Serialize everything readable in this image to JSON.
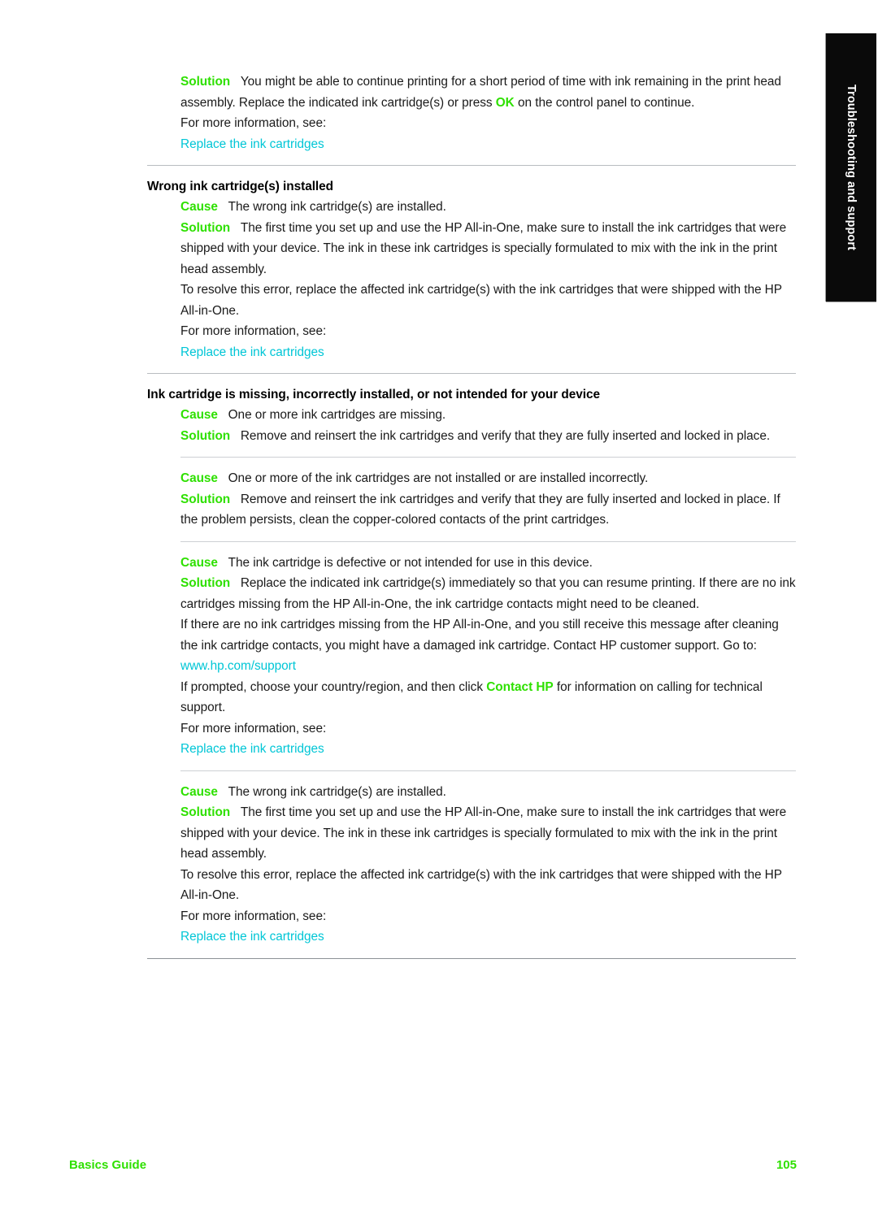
{
  "document": {
    "chapter_tab_label": "Troubleshooting and support",
    "footer_left": "Basics Guide",
    "footer_page_number": "105",
    "colors": {
      "label_green": "#2ee000",
      "link_cyan": "#00c6d6",
      "tab_background": "#0a0a0a",
      "rule_gray": "#b9bcc0"
    },
    "labels": {
      "cause": "Cause",
      "solution": "Solution",
      "for_more_information": "For more information, see:",
      "link_replace_cartridges": "Replace the ink cartridges",
      "link_support_url": "www.hp.com/support"
    }
  },
  "blocks": {
    "intro_solution": {
      "body_1": "You might be able to continue printing for a short period of time with ink remaining in the print head assembly. Replace the indicated ink cartridge(s) or press ",
      "inline_ok": "OK",
      "body_2": " on the control panel to continue."
    },
    "wrong_cartridge": {
      "heading": "Wrong ink cartridge(s) installed",
      "cause": "The wrong ink cartridge(s) are installed.",
      "solution_p1": "The first time you set up and use the HP All-in-One, make sure to install the ink cartridges that were shipped with your device. The ink in these ink cartridges is specially formulated to mix with the ink in the print head assembly.",
      "solution_p2": "To resolve this error, replace the affected ink cartridge(s) with the ink cartridges that were shipped with the HP All-in-One."
    },
    "missing_cartridge": {
      "heading": "Ink cartridge is missing, incorrectly installed, or not intended for your device",
      "cause_1": "One or more ink cartridges are missing.",
      "solution_1": "Remove and reinsert the ink cartridges and verify that they are fully inserted and locked in place.",
      "cause_2": "One or more of the ink cartridges are not installed or are installed incorrectly.",
      "solution_2": "Remove and reinsert the ink cartridges and verify that they are fully inserted and locked in place. If the problem persists, clean the copper-colored contacts of the print cartridges.",
      "cause_3": "The ink cartridge is defective or not intended for use in this device.",
      "solution_3_p1": "Replace the indicated ink cartridge(s) immediately so that you can resume printing. If there are no ink cartridges missing from the HP All-in-One, the ink cartridge contacts might need to be cleaned.",
      "solution_3_p2": "If there are no ink cartridges missing from the HP All-in-One, and you still receive this message after cleaning the ink cartridge contacts, you might have a damaged ink cartridge. Contact HP customer support. Go to:",
      "solution_3_p3_before": "If prompted, choose your country/region, and then click ",
      "solution_3_p3_link": "Contact HP",
      "solution_3_p3_after": " for information on calling for technical support.",
      "cause_4": "The wrong ink cartridge(s) are installed.",
      "solution_4_p1": "The first time you set up and use the HP All-in-One, make sure to install the ink cartridges that were shipped with your device. The ink in these ink cartridges is specially formulated to mix with the ink in the print head assembly.",
      "solution_4_p2": "To resolve this error, replace the affected ink cartridge(s) with the ink cartridges that were shipped with the HP All-in-One."
    }
  }
}
